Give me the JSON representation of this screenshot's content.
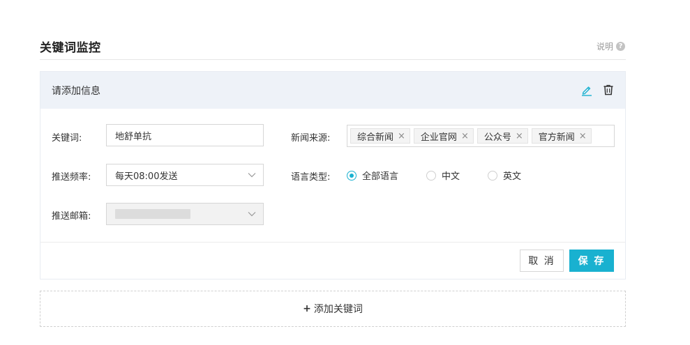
{
  "page": {
    "title": "关键词监控",
    "help_label": "说明",
    "help_icon": "?"
  },
  "card": {
    "header_title": "请添加信息",
    "icons": {
      "edit": "pencil-icon",
      "delete": "trash-icon"
    },
    "fields": {
      "keyword": {
        "label": "关键词:",
        "value": "地舒单抗"
      },
      "frequency": {
        "label": "推送频率:",
        "value": "每天08:00发送"
      },
      "email": {
        "label": "推送邮箱:"
      },
      "news_source": {
        "label": "新闻来源:",
        "tags": [
          "综合新闻",
          "企业官网",
          "公众号",
          "官方新闻"
        ],
        "tag_close": "×"
      },
      "language": {
        "label": "语言类型:",
        "options": [
          "全部语言",
          "中文",
          "英文"
        ],
        "selected": "全部语言"
      }
    },
    "buttons": {
      "cancel": "取 消",
      "save": "保 存"
    }
  },
  "add_keyword": {
    "plus": "+",
    "label": "添加关键词"
  },
  "colors": {
    "accent": "#19b1d0",
    "header_bg": "#eef2f8"
  }
}
